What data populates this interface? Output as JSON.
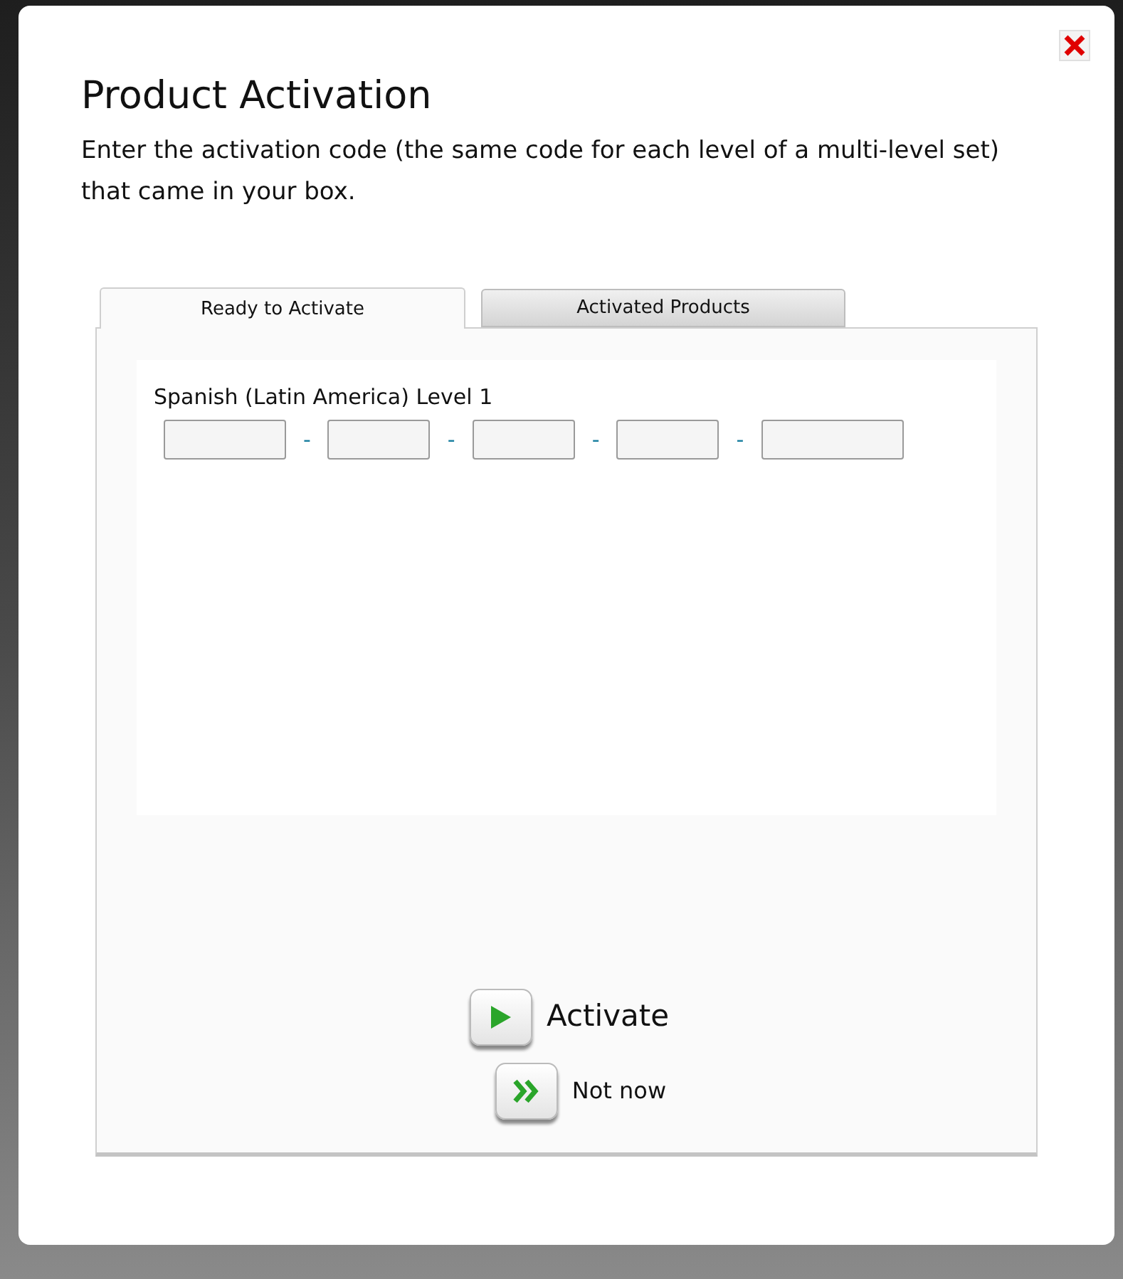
{
  "dialog": {
    "title": "Product Activation",
    "description": "Enter the activation code (the same code for each level of a multi-level set) that came in your box."
  },
  "tabs": [
    {
      "label": "Ready to Activate",
      "selected": true
    },
    {
      "label": "Activated Products",
      "selected": false
    }
  ],
  "product": {
    "name": "Spanish (Latin America) Level 1",
    "code_segments": [
      {
        "kind": "field"
      },
      {
        "kind": "separator",
        "text": "-"
      },
      {
        "kind": "field"
      },
      {
        "kind": "separator",
        "text": "-"
      },
      {
        "kind": "field"
      },
      {
        "kind": "separator",
        "text": "-"
      },
      {
        "kind": "field"
      },
      {
        "kind": "separator",
        "text": "-"
      },
      {
        "kind": "field"
      }
    ]
  },
  "buttons": [
    {
      "kind": "activate",
      "label": "Activate"
    },
    {
      "kind": "skip",
      "label": "Not now"
    }
  ]
}
